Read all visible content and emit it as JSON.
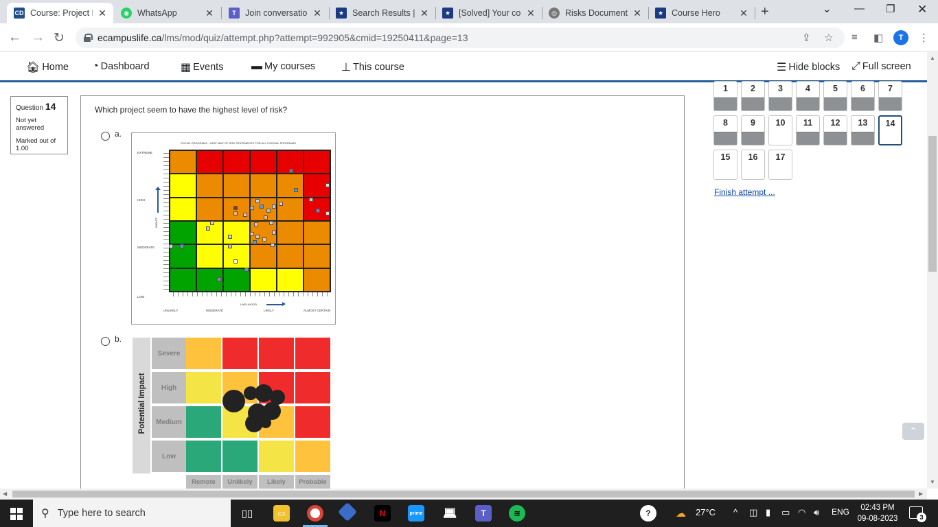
{
  "browser": {
    "tabs": [
      {
        "title": "Course: Project R",
        "fav_text": "CD",
        "fav_color": "#1f4e8c",
        "active": true
      },
      {
        "title": "WhatsApp",
        "fav_text": "◉",
        "fav_color": "#25d366"
      },
      {
        "title": "Join conversation",
        "fav_text": "T",
        "fav_color": "#5b5fc7"
      },
      {
        "title": "Search Results | C",
        "fav_text": "★",
        "fav_color": "#1c3a82"
      },
      {
        "title": "[Solved] Your cor",
        "fav_text": "★",
        "fav_color": "#1c3a82"
      },
      {
        "title": "Risks Documenta",
        "fav_text": "◎",
        "fav_color": "#777777"
      },
      {
        "title": "Course Hero",
        "fav_text": "★",
        "fav_color": "#1c3a82"
      }
    ],
    "url_host": "ecampuslife.ca",
    "url_path": "/lms/mod/quiz/attempt.php?attempt=992905&cmid=19250411&page=13",
    "profile_initial": "T"
  },
  "navbar": {
    "home": "Home",
    "dashboard": "Dashboard",
    "events": "Events",
    "my_courses": "My courses",
    "this_course": "This course",
    "hide_blocks": "Hide blocks",
    "full_screen": "Full screen"
  },
  "question_info": {
    "label": "Question",
    "number": "14",
    "state": "Not yet answered",
    "marked": "Marked out of 1.00"
  },
  "question": {
    "text": "Which project seem to have the highest level of risk?",
    "option_a": "a.",
    "option_b": "b."
  },
  "heatmap_a": {
    "title": "SOCIAL PROGRAMS - HEAT MAP OF RISK STATEMENTS FOR ALL 5 SOCIAL PROGRAMS",
    "impact_levels": [
      "EXTREME",
      "HIGH",
      "MODERATE",
      "LOW"
    ],
    "impact_axis": "IMPACT",
    "likelihood_axis": "LIKELIHOOD",
    "likelihood_levels": [
      "UNLIKELY",
      "MODERATE",
      "LIKELY",
      "ALMOST CERTAIN"
    ]
  },
  "heatmap_b": {
    "y_title": "Potential Impact",
    "rows": [
      "Severe",
      "High",
      "Medium",
      "Low"
    ],
    "cols": [
      "Remote",
      "Unlikely",
      "Likely",
      "Probable"
    ]
  },
  "quiz_nav": {
    "questions": [
      {
        "n": "1",
        "answered": true
      },
      {
        "n": "2",
        "answered": true
      },
      {
        "n": "3",
        "answered": true
      },
      {
        "n": "4",
        "answered": true
      },
      {
        "n": "5",
        "answered": true
      },
      {
        "n": "6",
        "answered": true
      },
      {
        "n": "7",
        "answered": true
      },
      {
        "n": "8",
        "answered": true
      },
      {
        "n": "9",
        "answered": true
      },
      {
        "n": "10",
        "answered": false
      },
      {
        "n": "11",
        "answered": true
      },
      {
        "n": "12",
        "answered": true
      },
      {
        "n": "13",
        "answered": true
      },
      {
        "n": "14",
        "answered": false,
        "current": true
      },
      {
        "n": "15",
        "answered": false
      },
      {
        "n": "16",
        "answered": false
      },
      {
        "n": "17",
        "answered": false
      }
    ],
    "finish_label": "Finish attempt ..."
  },
  "taskbar": {
    "search_placeholder": "Type here to search",
    "temperature": "27°C",
    "language": "ENG",
    "time": "02:43 PM",
    "date": "09-08-2023",
    "notifications": "3"
  }
}
